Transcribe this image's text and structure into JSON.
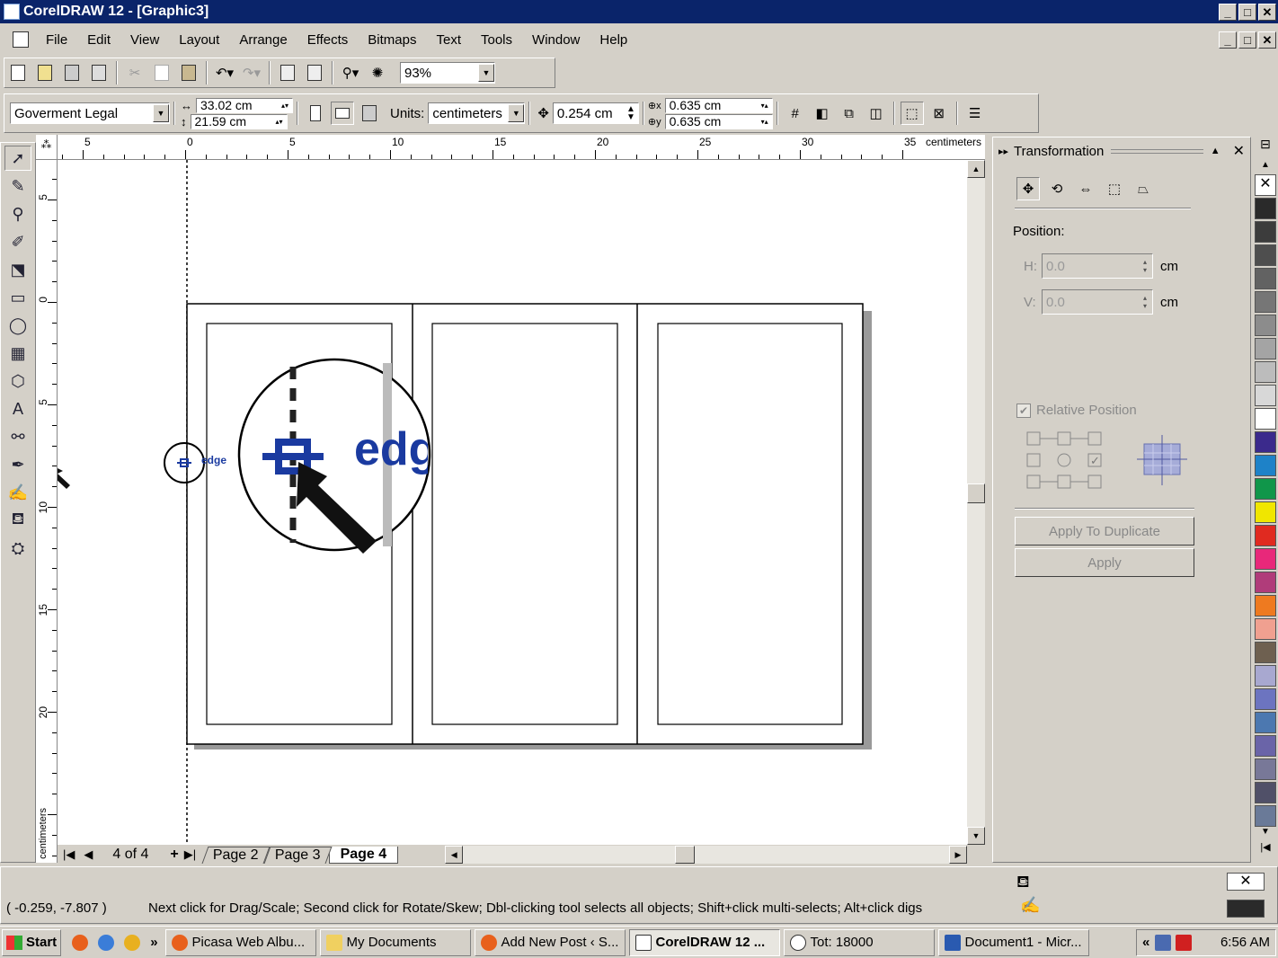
{
  "window": {
    "title": "CorelDRAW 12 - [Graphic3]",
    "controls": [
      "_",
      "□",
      "✕"
    ]
  },
  "menu": [
    "File",
    "Edit",
    "View",
    "Layout",
    "Arrange",
    "Effects",
    "Bitmaps",
    "Text",
    "Tools",
    "Window",
    "Help"
  ],
  "standard_toolbar": {
    "zoom_value": "93%"
  },
  "property_bar": {
    "paper_size": "Goverment Legal",
    "width": "33.02 cm",
    "height": "21.59 cm",
    "units_label": "Units:",
    "units_value": "centimeters",
    "nudge": "0.254 cm",
    "dup_x": "0.635 cm",
    "dup_y": "0.635 cm"
  },
  "rulers": {
    "unit_label": "centimeters",
    "h_ticks": [
      "5",
      "0",
      "5",
      "10",
      "15",
      "20",
      "25",
      "30",
      "35"
    ],
    "v_ticks": [
      "5",
      "0",
      "5",
      "10",
      "15",
      "20"
    ]
  },
  "canvas": {
    "guide_label": "edge",
    "zoom_label": "edg"
  },
  "page_nav": {
    "counter": "4 of 4",
    "tabs": [
      "Page 2",
      "Page 3",
      "Page 4"
    ],
    "active_tab": "Page 4"
  },
  "docker": {
    "title": "Transformation",
    "position_label": "Position:",
    "h_label": "H:",
    "h_value": "0.0",
    "v_label": "V:",
    "v_value": "0.0",
    "unit": "cm",
    "relative_label": "Relative Position",
    "apply_duplicate": "Apply To Duplicate",
    "apply": "Apply"
  },
  "palette": {
    "colors": [
      "#ffffff",
      "#2a2a2a",
      "#3c3c3c",
      "#4e4e4e",
      "#626262",
      "#767676",
      "#8c8c8c",
      "#a4a4a4",
      "#bcbcbc",
      "#d8d8d8",
      "#ffffff",
      "#3b2a8c",
      "#1e82c8",
      "#10964a",
      "#f0e600",
      "#e02a20",
      "#e8287a",
      "#b03c7a",
      "#ee7a20",
      "#f0a090",
      "#6e6050",
      "#a8a8d0",
      "#6c74c0",
      "#4c78b0",
      "#6a64a8",
      "#787898",
      "#505068",
      "#6a7a98"
    ]
  },
  "status": {
    "coords": "( -0.259, -7.807 )",
    "hint": "Next click for Drag/Scale; Second click for Rotate/Skew; Dbl-clicking tool selects all objects; Shift+click multi-selects; Alt+click digs"
  },
  "taskbar": {
    "start": "Start",
    "more": "»",
    "tasks": [
      "Picasa Web Albu...",
      "My Documents",
      "Add New Post ‹ S...",
      "CorelDRAW 12 ...",
      "Tot: 18000",
      "Document1 - Micr..."
    ],
    "tray_chevron": "«",
    "clock": "6:56 AM"
  }
}
